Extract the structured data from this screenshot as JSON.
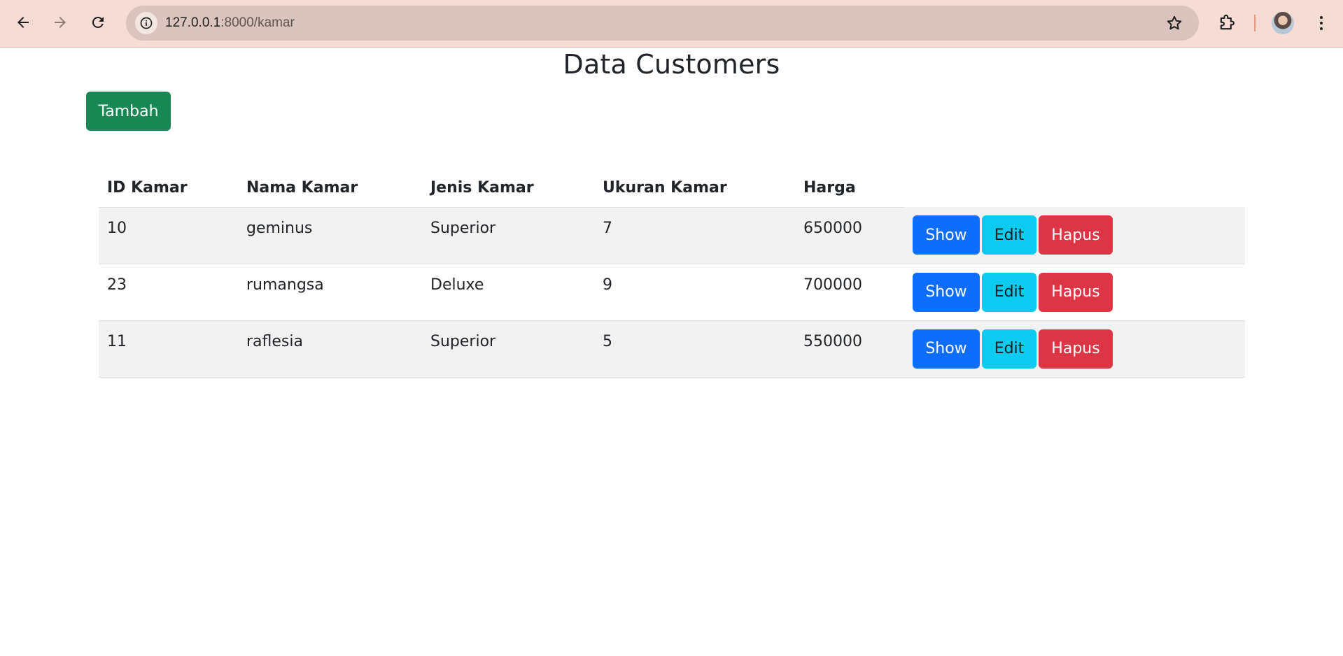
{
  "browser": {
    "url_host": "127.0.0.1",
    "url_rest": ":8000/kamar",
    "accent": "#f6dcd4"
  },
  "page": {
    "title": "Data Customers",
    "add_button": "Tambah"
  },
  "table": {
    "headers": [
      "ID Kamar",
      "Nama Kamar",
      "Jenis Kamar",
      "Ukuran Kamar",
      "Harga"
    ],
    "rows": [
      {
        "id": "10",
        "nama": "geminus",
        "jenis": "Superior",
        "ukuran": "7",
        "harga": "650000"
      },
      {
        "id": "23",
        "nama": "rumangsa",
        "jenis": "Deluxe",
        "ukuran": "9",
        "harga": "700000"
      },
      {
        "id": "11",
        "nama": "raflesia",
        "jenis": "Superior",
        "ukuran": "5",
        "harga": "550000"
      }
    ],
    "actions": {
      "show": "Show",
      "edit": "Edit",
      "hapus": "Hapus"
    }
  },
  "colors": {
    "add": "#198754",
    "show": "#0d6efd",
    "edit": "#0dcaf0",
    "hapus": "#dc3545"
  }
}
